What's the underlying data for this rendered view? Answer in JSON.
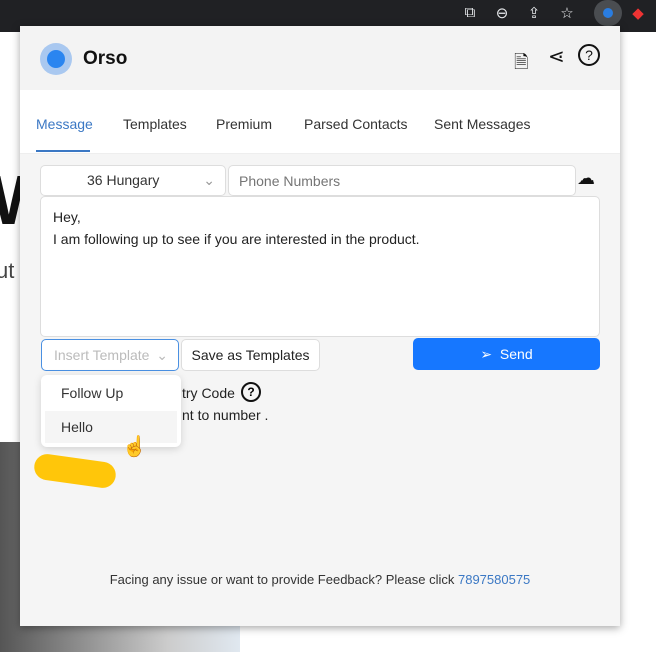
{
  "browser": {
    "icons": [
      "open-in-new-icon",
      "zoom-out-icon",
      "share-icon",
      "star-icon",
      "extension-icon",
      "extension-2-icon"
    ]
  },
  "background": {
    "big_letter": "W",
    "partial_text": "ut"
  },
  "app": {
    "title": "Orso",
    "accent": "#1677ff"
  },
  "tabs": [
    "Message",
    "Templates",
    "Premium",
    "Parsed Contacts",
    "Sent Messages"
  ],
  "active_tab": "Message",
  "country_select": {
    "value": "36 Hungary"
  },
  "phone": {
    "placeholder": "Phone Numbers",
    "value": ""
  },
  "message": {
    "line1": "Hey,",
    "line2": "I am following up to see if you are interested in the product."
  },
  "template_select": {
    "placeholder": "Insert Template",
    "options": [
      "Follow Up",
      "Hello"
    ],
    "hovered": "Hello"
  },
  "save_templates_label": "Save as Templates",
  "send_label": "Send",
  "obscured": {
    "country_code": "try Code",
    "convert": "nt to number ."
  },
  "footer": {
    "text": "Facing any issue or want to provide Feedback? Please click ",
    "link": "7897580575"
  }
}
